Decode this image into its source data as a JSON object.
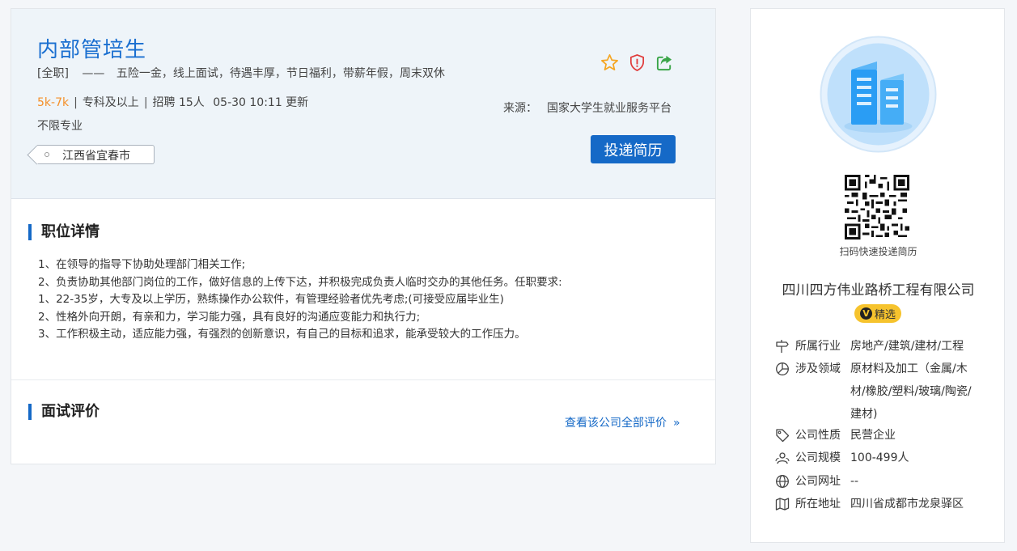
{
  "job": {
    "title": "内部管培生",
    "type_tag": "[全职]",
    "dash": "——",
    "welfare": "五险一金，线上面试，待遇丰厚，节日福利，带薪年假，周末双休",
    "salary": "5k-7k",
    "sep": "|",
    "education": "专科及以上",
    "recruit": "招聘 15人",
    "updated": "05-30 10:11 更新",
    "major": "不限专业",
    "location": "江西省宜春市",
    "source_label": "来源：",
    "source_value": "国家大学生就业服务平台",
    "apply_label": "投递简历"
  },
  "icons": {
    "favorite": "star-icon",
    "report": "shield-alert-icon",
    "share": "share-icon"
  },
  "details": {
    "title": "职位详情",
    "lines": [
      "1、在领导的指导下协助处理部门相关工作;",
      "2、负责协助其他部门岗位的工作，做好信息的上传下达，并积极完成负责人临时交办的其他任务。任职要求:",
      "1、22-35岁，大专及以上学历，熟练操作办公软件，有管理经验者优先考虑;(可接受应届毕业生)",
      "2、性格外向开朗，有亲和力，学习能力强，具有良好的沟通应变能力和执行力;",
      "3、工作积极主动，适应能力强，有强烈的创新意识，有自己的目标和追求，能承受较大的工作压力。"
    ]
  },
  "review": {
    "title": "面试评价",
    "link": "查看该公司全部评价",
    "chevron": "»"
  },
  "company": {
    "qr_label": "扫码快速投递简历",
    "name": "四川四方伟业路桥工程有限公司",
    "badge_v": "V",
    "badge_text": "精选",
    "info": [
      {
        "icon": "signpost-icon",
        "label": "所属行业",
        "value": "房地产/建筑/建材/工程"
      },
      {
        "icon": "pie-chart-icon",
        "label": "涉及领域",
        "value": "原材料及加工（金属/木材/橡胶/塑料/玻璃/陶瓷/建材)"
      },
      {
        "icon": "tag-icon",
        "label": "公司性质",
        "value": "民营企业"
      },
      {
        "icon": "people-icon",
        "label": "公司规模",
        "value": "100-499人"
      },
      {
        "icon": "globe-icon",
        "label": "公司网址",
        "value": "--"
      },
      {
        "icon": "map-icon",
        "label": "所在地址",
        "value": "四川省成都市龙泉驿区"
      }
    ]
  },
  "colors": {
    "primary": "#1569c7",
    "salary": "#f5902a",
    "badge": "#f6c32d",
    "header_bg": "#eef4f9"
  }
}
